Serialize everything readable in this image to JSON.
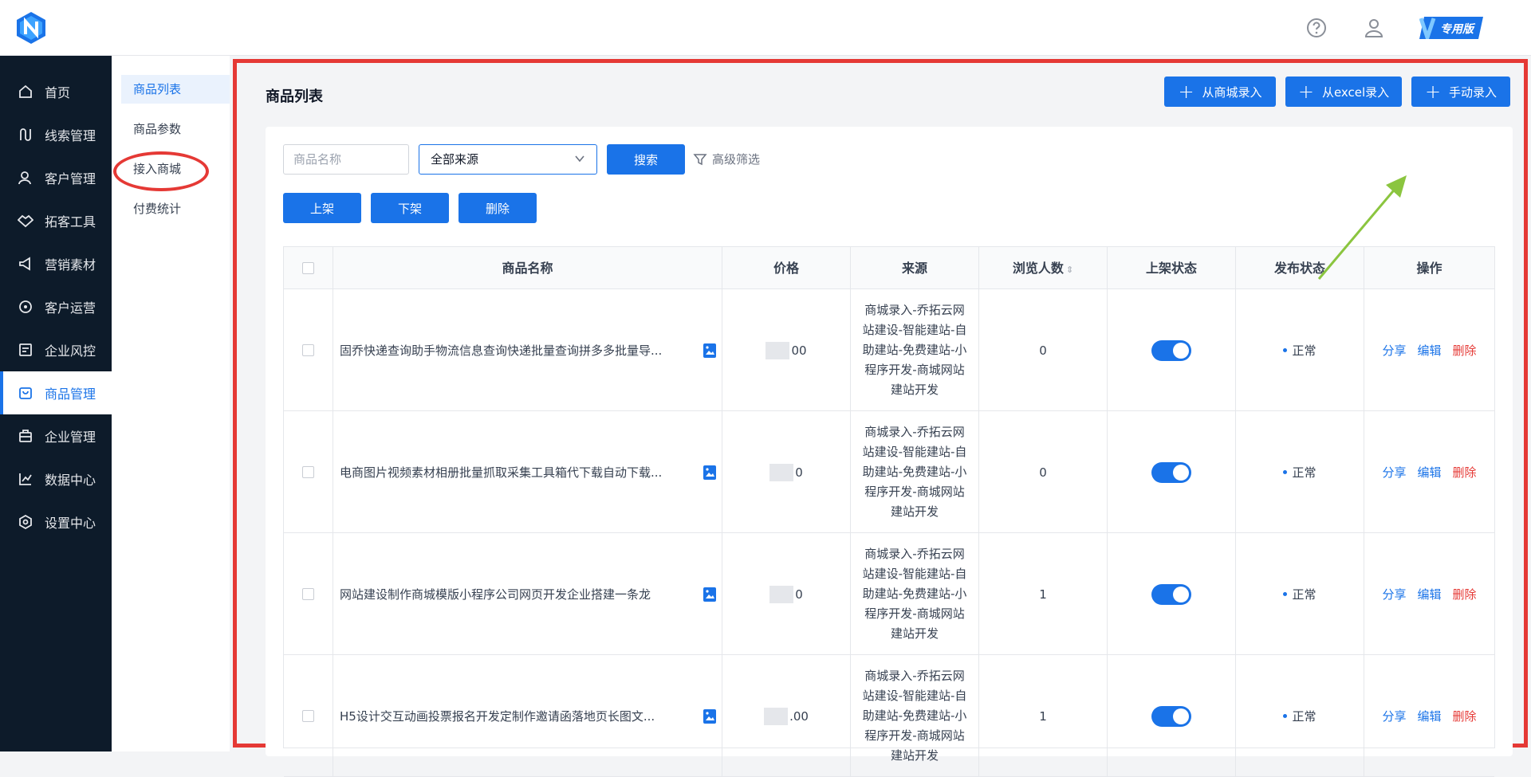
{
  "header": {
    "badge_label": "专用版",
    "icons": [
      "help-icon",
      "user-icon"
    ]
  },
  "sidebar": {
    "items": [
      {
        "label": "首页",
        "icon": "home-icon"
      },
      {
        "label": "线索管理",
        "icon": "clue-icon"
      },
      {
        "label": "客户管理",
        "icon": "customers-icon"
      },
      {
        "label": "拓客工具",
        "icon": "handshake-icon"
      },
      {
        "label": "营销素材",
        "icon": "megaphone-icon"
      },
      {
        "label": "客户运营",
        "icon": "operation-icon"
      },
      {
        "label": "企业风控",
        "icon": "risk-icon"
      },
      {
        "label": "商品管理",
        "icon": "bag-icon",
        "active": true
      },
      {
        "label": "企业管理",
        "icon": "briefcase-icon"
      },
      {
        "label": "数据中心",
        "icon": "chart-icon"
      },
      {
        "label": "设置中心",
        "icon": "settings-icon"
      }
    ]
  },
  "subnav": {
    "items": [
      {
        "label": "商品列表",
        "active": true
      },
      {
        "label": "商品参数"
      },
      {
        "label": "接入商城"
      },
      {
        "label": "付费统计"
      }
    ]
  },
  "main": {
    "title": "商品列表",
    "actions": [
      "从商城录入",
      "从excel录入",
      "手动录入"
    ],
    "search": {
      "placeholder": "商品名称",
      "source_value": "全部来源",
      "search_label": "搜索",
      "advanced_label": "高级筛选"
    },
    "bulk": [
      "上架",
      "下架",
      "删除"
    ],
    "table": {
      "columns": [
        "商品名称",
        "价格",
        "来源",
        "浏览人数",
        "上架状态",
        "发布状态",
        "操作"
      ],
      "rows": [
        {
          "name": "固乔快递查询助手物流信息查询快递批量查询拼多多批量导...",
          "price_suffix": "00",
          "source": "商城录入-乔拓云网站建设-智能建站-自助建站-免费建站-小程序开发-商城网站建站开发",
          "views": "0",
          "publish": "正常"
        },
        {
          "name": "电商图片视频素材相册批量抓取采集工具箱代下载自动下载...",
          "price_suffix": "0",
          "source": "商城录入-乔拓云网站建设-智能建站-自助建站-免费建站-小程序开发-商城网站建站开发",
          "views": "0",
          "publish": "正常"
        },
        {
          "name": "网站建设制作商城模版小程序公司网页开发企业搭建一条龙",
          "price_suffix": "0",
          "source": "商城录入-乔拓云网站建设-智能建站-自助建站-免费建站-小程序开发-商城网站建站开发",
          "views": "1",
          "publish": "正常"
        },
        {
          "name": "H5设计交互动画投票报名开发定制作邀请函落地页长图文...",
          "price_suffix": ".00",
          "source": "商城录入-乔拓云网站建设-智能建站-自助建站-免费建站-小程序开发-商城网站建站开发",
          "views": "1",
          "publish": "正常"
        }
      ],
      "ops": [
        "分享",
        "编辑",
        "删除"
      ]
    }
  },
  "colors": {
    "accent": "#1a73e8",
    "sidebar_bg": "#0d1b2a",
    "highlight_red": "#e53935",
    "arrow_green": "#8bc53f"
  }
}
